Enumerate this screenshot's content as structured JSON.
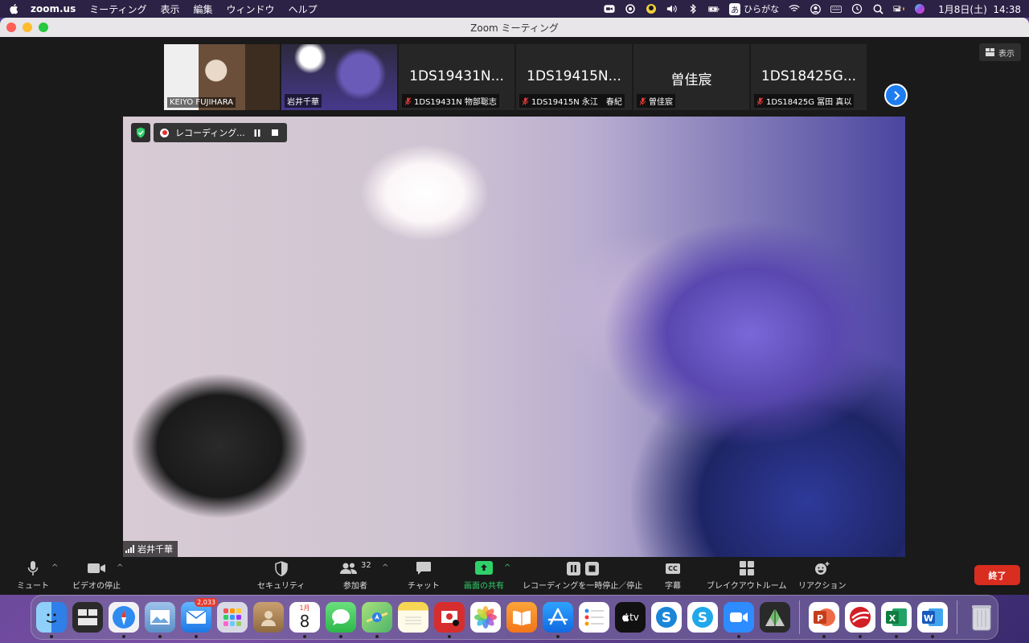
{
  "menubar": {
    "app_name": "zoom.us",
    "items": [
      "ミーティング",
      "表示",
      "編集",
      "ウィンドウ",
      "ヘルプ"
    ],
    "input_method": "ひらがな",
    "input_label": "あ",
    "datetime": "1月8日(土)  14:38"
  },
  "window": {
    "title": "Zoom ミーティング"
  },
  "thumbnails": [
    {
      "big_name": "",
      "label": "KEIYO FUJIHARA",
      "muted": false,
      "active": false,
      "has_video": "pic1"
    },
    {
      "big_name": "",
      "label": "岩井千華",
      "muted": false,
      "active": true,
      "has_video": "pic2"
    },
    {
      "big_name": "1DS19431N...",
      "label": "1DS19431N 物部聡志",
      "muted": true,
      "active": false,
      "has_video": ""
    },
    {
      "big_name": "1DS19415N...",
      "label": "1DS19415N 永江　春紀",
      "muted": true,
      "active": false,
      "has_video": ""
    },
    {
      "big_name": "曽佳宸",
      "label": "曽佳宸",
      "muted": true,
      "active": false,
      "has_video": ""
    },
    {
      "big_name": "1DS18425G...",
      "label": "1DS18425G 冨田 真以",
      "muted": true,
      "active": false,
      "has_video": ""
    }
  ],
  "view_button": "表示",
  "recording": {
    "label": "レコーディング..."
  },
  "speaker": {
    "name": "岩井千華"
  },
  "toolbar": {
    "mute": "ミュート",
    "video": "ビデオの停止",
    "security": "セキュリティ",
    "participants": "参加者",
    "participants_count": "32",
    "chat": "チャット",
    "share": "画面の共有",
    "recording": "レコーディングを一時停止／停止",
    "captions": "字幕",
    "captions_icon": "CC",
    "breakout": "ブレイクアウトルーム",
    "reactions": "リアクション",
    "end": "終了"
  },
  "dock": {
    "mail_badge": "2,033",
    "calendar_month": "1月",
    "calendar_day": "8",
    "tv_label": "tv",
    "apps": [
      {
        "name": "finder",
        "color": "#3a8ef0"
      },
      {
        "name": "mission-control",
        "color": "#2a2a2a"
      },
      {
        "name": "safari",
        "color": "#2e8cf0"
      },
      {
        "name": "preview",
        "color": "#7aa7d8"
      },
      {
        "name": "mail",
        "color": "#3b93f5"
      },
      {
        "name": "launchpad",
        "color": "#d9d9e6"
      },
      {
        "name": "contacts",
        "color": "#b8905e"
      },
      {
        "name": "calendar",
        "color": "#ffffff"
      },
      {
        "name": "messages",
        "color": "#38c95a"
      },
      {
        "name": "maps",
        "color": "#6fc06a"
      },
      {
        "name": "notes",
        "color": "#f7d654"
      },
      {
        "name": "photo-booth",
        "color": "#d62e2e"
      },
      {
        "name": "photos",
        "color": "#ffffff"
      },
      {
        "name": "books",
        "color": "#f58a1f"
      },
      {
        "name": "app-store",
        "color": "#1b8cf2"
      },
      {
        "name": "reminders",
        "color": "#ffffff"
      },
      {
        "name": "apple-tv",
        "color": "#111111"
      },
      {
        "name": "skype-business",
        "color": "#1a86d8"
      },
      {
        "name": "skype",
        "color": "#1fa8ea"
      },
      {
        "name": "zoom",
        "color": "#2d8cff"
      },
      {
        "name": "camino",
        "color": "#2a2a2a"
      },
      {
        "name": "powerpoint",
        "color": "#d24625"
      },
      {
        "name": "trend-micro",
        "color": "#d21f26"
      },
      {
        "name": "excel",
        "color": "#1d7444"
      },
      {
        "name": "word",
        "color": "#2b579a"
      },
      {
        "name": "trash",
        "color": "#c8c8d0"
      }
    ]
  }
}
